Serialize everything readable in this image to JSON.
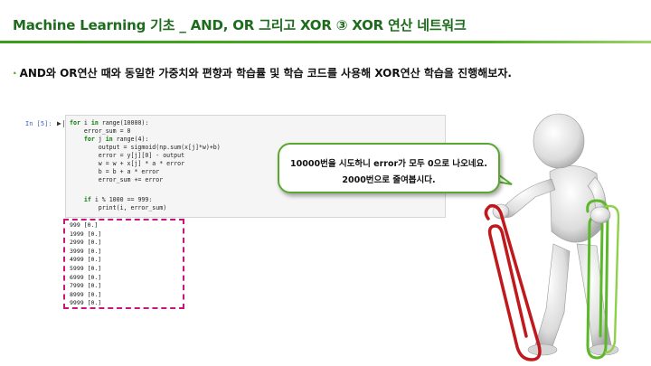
{
  "slide": {
    "title": "Machine Learning 기초 _ AND, OR 그리고 XOR ③ XOR 연산 네트워크",
    "bullet_text": "AND와 OR연산 때와 동일한 가중치와 편향과 학습률 및 학습 코드를 사용해 XOR연산 학습을 진행해보자."
  },
  "notebook": {
    "prompt": "In [5]:",
    "run_marker": "▶|",
    "code": {
      "l1_kw": "for",
      "l1_rest": " i ",
      "l1_kw2": "in",
      "l1_tail": " range(10000):",
      "l2": "    error_sum = 0",
      "l3_pre": "    ",
      "l3_kw": "for",
      "l3_mid": " j ",
      "l3_kw2": "in",
      "l3_tail": " range(4):",
      "l4": "        output = sigmoid(np.sum(x[j]*w)+b)",
      "l5": "        error = y[j][0] - output",
      "l6": "        w = w + x[j] * a * error",
      "l7": "        b = b + a * error",
      "l8": "        error_sum += error",
      "l9_pre": "    ",
      "l9_kw": "if",
      "l9_tail": " i % 1000 == 999:",
      "l10": "        print(i, error_sum)"
    },
    "output_lines": [
      "999 [0.]",
      "1999 [0.]",
      "2999 [0.]",
      "3999 [0.]",
      "4999 [0.]",
      "5999 [0.]",
      "6999 [0.]",
      "7999 [0.]",
      "8999 [0.]",
      "9999 [0.]"
    ]
  },
  "callout": {
    "line1": "10000번을 시도하니 error가 모두 0으로 나오네요.",
    "line2": "2000번으로 줄여봅시다."
  },
  "colors": {
    "title_green": "#1e6b1e",
    "rule_green": "#4cae24",
    "keyword_green": "#0a7d0a",
    "dashed_box": "#c8157d",
    "callout_border": "#5aa830",
    "paperclip_red": "#c0181c",
    "paperclip_green": "#5cb82a"
  },
  "figure": {
    "icon": "person-holding-paperclips-icon"
  }
}
